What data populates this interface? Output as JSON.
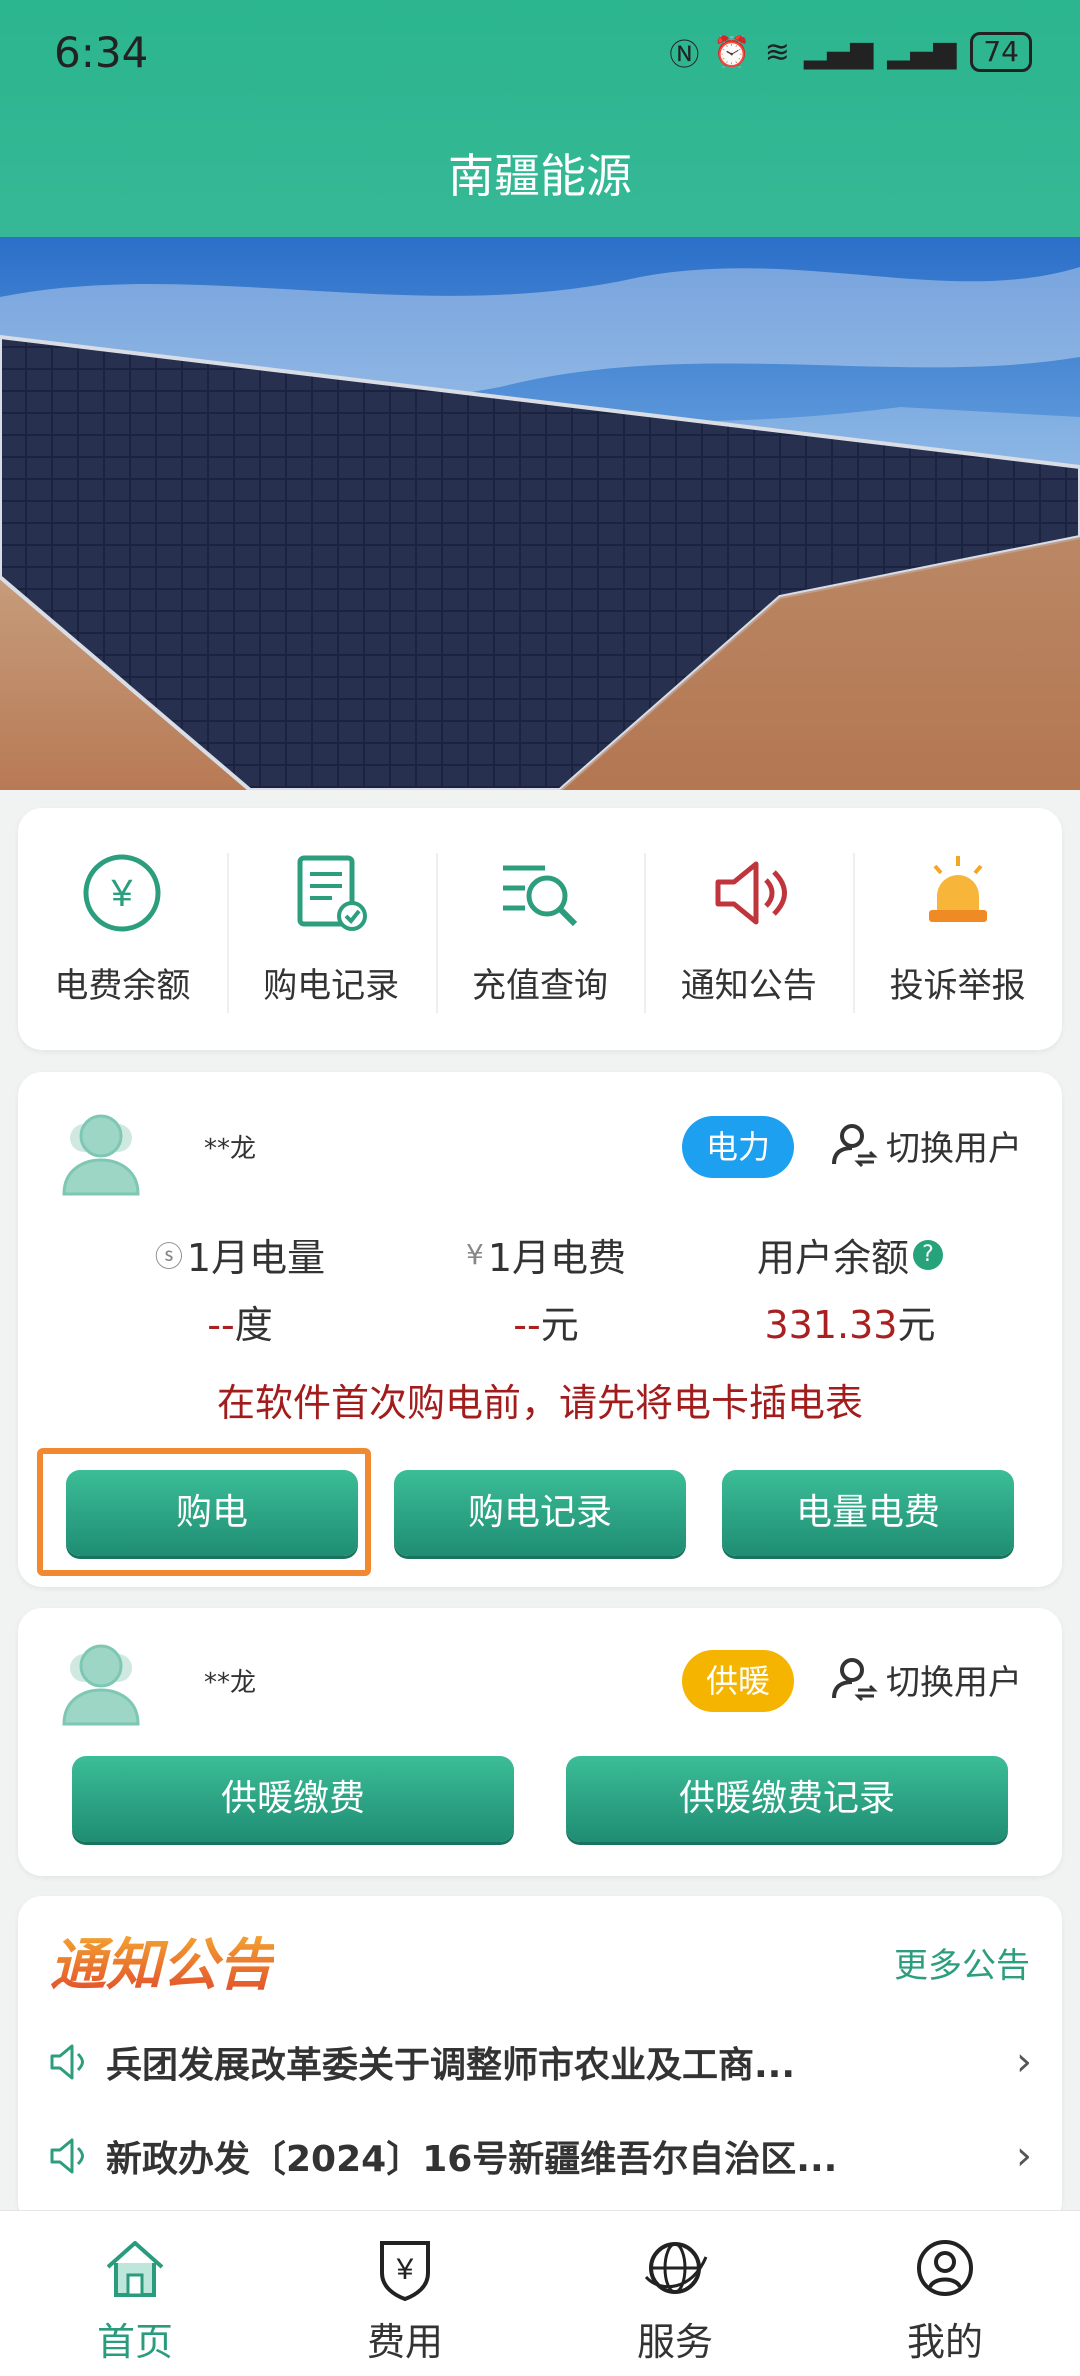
{
  "status": {
    "time": "6:34",
    "battery": "74"
  },
  "header": {
    "title": "南疆能源"
  },
  "quick_menu": [
    {
      "label": "电费余额",
      "icon": "yen-circle-icon"
    },
    {
      "label": "购电记录",
      "icon": "record-document-icon"
    },
    {
      "label": "充值查询",
      "icon": "search-list-icon"
    },
    {
      "label": "通知公告",
      "icon": "speaker-icon"
    },
    {
      "label": "投诉举报",
      "icon": "alarm-light-icon"
    }
  ],
  "power_account": {
    "user_name": "**龙",
    "type_badge": "电力",
    "switch_label": "切换用户",
    "stats": [
      {
        "label": "1月电量",
        "value": "--",
        "unit": "度"
      },
      {
        "label": "1月电费",
        "value": "--",
        "unit": "元"
      },
      {
        "label": "用户余额",
        "value": "331.33",
        "unit": "元"
      }
    ],
    "notice": "在软件首次购电前，请先将电卡插电表",
    "buttons": {
      "buy": "购电",
      "records": "购电记录",
      "usage": "电量电费"
    }
  },
  "heat_account": {
    "user_name": "**龙",
    "type_badge": "供暖",
    "switch_label": "切换用户",
    "buttons": {
      "pay": "供暖缴费",
      "records": "供暖缴费记录"
    }
  },
  "announcements": {
    "title": "通知公告",
    "more": "更多公告",
    "items": [
      "兵团发展改革委关于调整师市农业及工商...",
      "新政办发〔2024〕16号新疆维吾尔自治区..."
    ]
  },
  "bottom_nav": [
    {
      "label": "首页",
      "icon": "home-icon",
      "active": true
    },
    {
      "label": "费用",
      "icon": "yen-shield-icon",
      "active": false
    },
    {
      "label": "服务",
      "icon": "globe-icon",
      "active": false
    },
    {
      "label": "我的",
      "icon": "profile-icon",
      "active": false
    }
  ],
  "colors": {
    "brand": "#2bb58e",
    "button": "#1f8d73",
    "power_badge": "#1ea0f0",
    "heat_badge": "#f5b400",
    "alert_text": "#a31c1c",
    "highlight_box": "#f0892f"
  }
}
